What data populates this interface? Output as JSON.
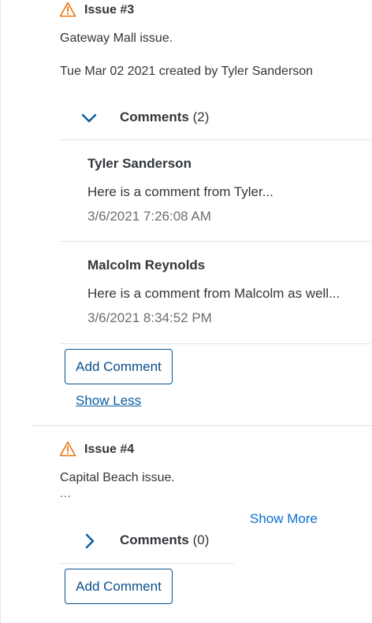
{
  "issues": [
    {
      "title": "Issue #3",
      "description": "Gateway Mall issue.",
      "meta": "Tue Mar 02 2021 created by Tyler Sanderson",
      "comments_label": "Comments",
      "comments_count": "(2)",
      "comments": [
        {
          "author": "Tyler Sanderson",
          "text": "Here is a comment from Tyler...",
          "date": "3/6/2021 7:26:08 AM"
        },
        {
          "author": "Malcolm Reynolds",
          "text": "Here is a comment from Malcolm as well...",
          "date": "3/6/2021 8:34:52 PM"
        }
      ],
      "add_comment_label": "Add Comment",
      "show_less_label": "Show Less"
    },
    {
      "title": "Issue #4",
      "description": "Capital Beach issue.",
      "ellipsis": "...",
      "show_more_label": "Show More",
      "comments_label": "Comments",
      "comments_count": "(0)",
      "add_comment_label": "Add Comment"
    }
  ],
  "colors": {
    "accent": "#0a6ed1",
    "warning": "#e9730c",
    "text": "#32363a",
    "muted": "#6a6d70"
  },
  "icons": {
    "warning": "warning-triangle-icon",
    "collapse": "chevron-down-icon",
    "expand": "chevron-right-icon"
  }
}
